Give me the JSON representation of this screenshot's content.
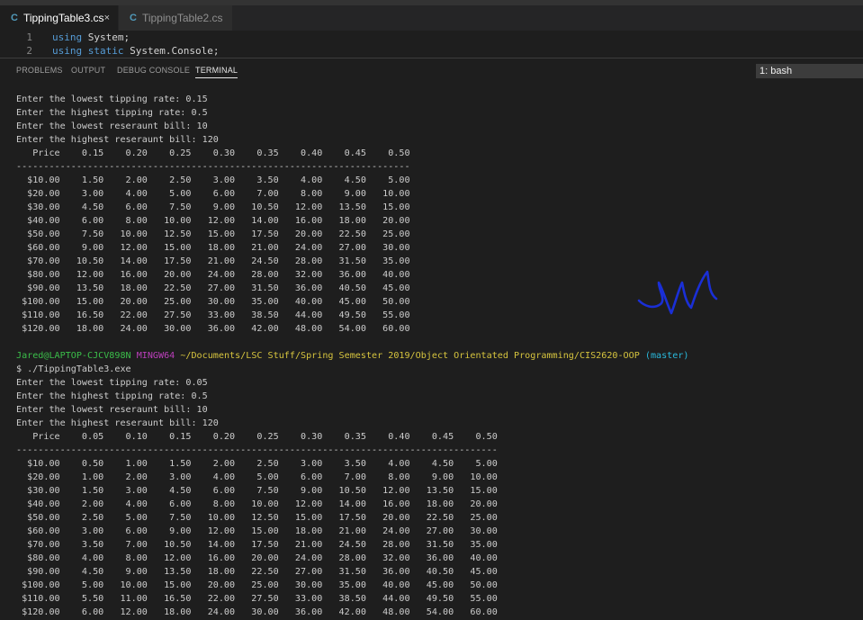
{
  "tabs": [
    {
      "label": "TippingTable3.cs",
      "active": true
    },
    {
      "label": "TippingTable2.cs",
      "active": false
    }
  ],
  "tab_close": "×",
  "editor": {
    "lines": [
      {
        "num": "1",
        "kw": "using",
        "rest": " System;"
      },
      {
        "num": "2",
        "kw": "using static",
        "rest": " System.Console;"
      }
    ]
  },
  "panel": {
    "tabs": [
      "PROBLEMS",
      "OUTPUT",
      "DEBUG CONSOLE",
      "TERMINAL"
    ],
    "active_tab": "TERMINAL",
    "shell": "1: bash"
  },
  "run1": {
    "prompts": [
      "Enter the lowest tipping rate: 0.15",
      "Enter the highest tipping rate: 0.5",
      "Enter the lowest reseraunt bill: 10",
      "Enter the highest reseraunt bill: 120"
    ],
    "header": "   Price    0.15    0.20    0.25    0.30    0.35    0.40    0.45    0.50",
    "divider": "------------------------------------------------------------------------",
    "rows": [
      "  $10.00    1.50    2.00    2.50    3.00    3.50    4.00    4.50    5.00",
      "  $20.00    3.00    4.00    5.00    6.00    7.00    8.00    9.00   10.00",
      "  $30.00    4.50    6.00    7.50    9.00   10.50   12.00   13.50   15.00",
      "  $40.00    6.00    8.00   10.00   12.00   14.00   16.00   18.00   20.00",
      "  $50.00    7.50   10.00   12.50   15.00   17.50   20.00   22.50   25.00",
      "  $60.00    9.00   12.00   15.00   18.00   21.00   24.00   27.00   30.00",
      "  $70.00   10.50   14.00   17.50   21.00   24.50   28.00   31.50   35.00",
      "  $80.00   12.00   16.00   20.00   24.00   28.00   32.00   36.00   40.00",
      "  $90.00   13.50   18.00   22.50   27.00   31.50   36.00   40.50   45.00",
      " $100.00   15.00   20.00   25.00   30.00   35.00   40.00   45.00   50.00",
      " $110.00   16.50   22.00   27.50   33.00   38.50   44.00   49.50   55.00",
      " $120.00   18.00   24.00   30.00   36.00   42.00   48.00   54.00   60.00"
    ]
  },
  "prompt_line": {
    "user": "Jared@LAPTOP-CJCV898N",
    "env": "MINGW64",
    "path": "~/Documents/LSC Stuff/Spring Semester 2019/Object Orientated Programming/CIS2620-OOP",
    "branch": "(master)"
  },
  "command": "$ ./TippingTable3.exe",
  "run2": {
    "prompts": [
      "Enter the lowest tipping rate: 0.05",
      "Enter the highest tipping rate: 0.5",
      "Enter the lowest reseraunt bill: 10",
      "Enter the highest reseraunt bill: 120"
    ],
    "header": "   Price    0.05    0.10    0.15    0.20    0.25    0.30    0.35    0.40    0.45    0.50",
    "divider": "----------------------------------------------------------------------------------------",
    "rows": [
      "  $10.00    0.50    1.00    1.50    2.00    2.50    3.00    3.50    4.00    4.50    5.00",
      "  $20.00    1.00    2.00    3.00    4.00    5.00    6.00    7.00    8.00    9.00   10.00",
      "  $30.00    1.50    3.00    4.50    6.00    7.50    9.00   10.50   12.00   13.50   15.00",
      "  $40.00    2.00    4.00    6.00    8.00   10.00   12.00   14.00   16.00   18.00   20.00",
      "  $50.00    2.50    5.00    7.50   10.00   12.50   15.00   17.50   20.00   22.50   25.00",
      "  $60.00    3.00    6.00    9.00   12.00   15.00   18.00   21.00   24.00   27.00   30.00",
      "  $70.00    3.50    7.00   10.50   14.00   17.50   21.00   24.50   28.00   31.50   35.00",
      "  $80.00    4.00    8.00   12.00   16.00   20.00   24.00   28.00   32.00   36.00   40.00",
      "  $90.00    4.50    9.00   13.50   18.00   22.50   27.00   31.50   36.00   40.50   45.00",
      " $100.00    5.00   10.00   15.00   20.00   25.00   30.00   35.00   40.00   45.00   50.00",
      " $110.00    5.50   11.00   16.50   22.00   27.50   33.00   38.50   44.00   49.50   55.00",
      " $120.00    6.00   12.00   18.00   24.00   30.00   36.00   42.00   48.00   54.00   60.00"
    ]
  },
  "colors": {
    "background": "#1e1e1e",
    "text": "#cccccc",
    "user": "#3bbf4a",
    "env": "#bc3fbc",
    "path": "#d6c43e",
    "branch": "#29b8db",
    "signature": "#1a2fd6"
  },
  "icons": {
    "file": "csharp-file-icon",
    "signature": "handwritten-signature"
  }
}
